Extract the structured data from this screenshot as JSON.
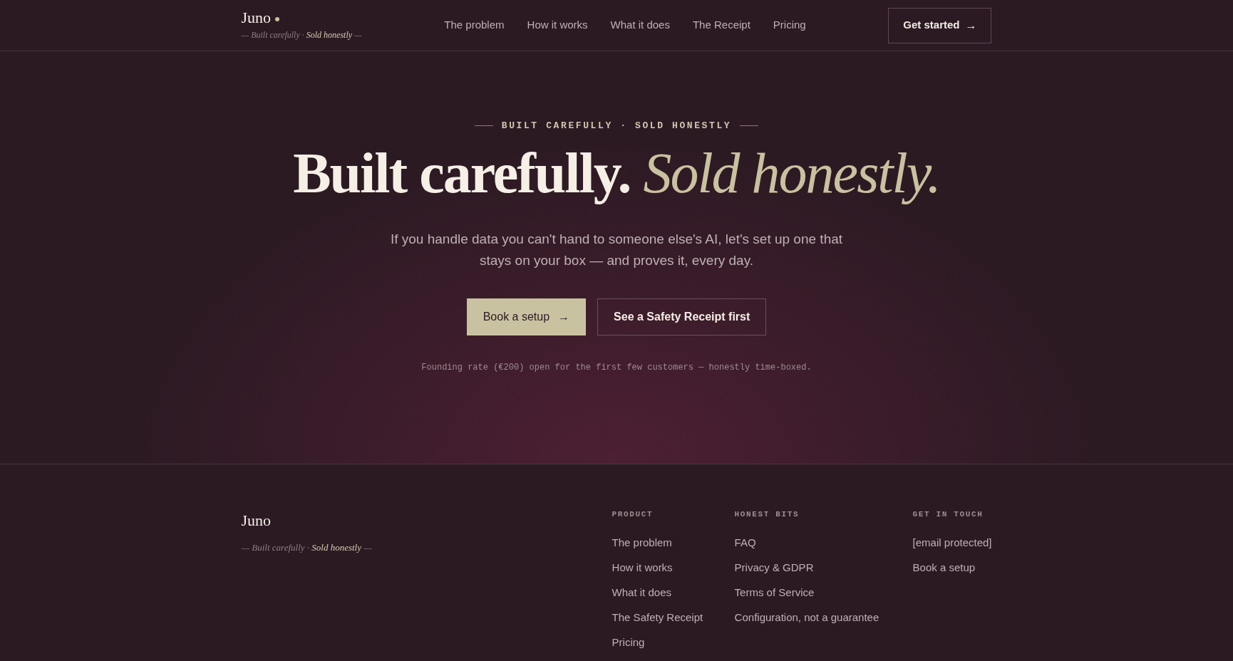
{
  "header": {
    "logo": "Juno",
    "tagline": [
      {
        "text": "— Built carefully ·",
        "kind": "muted"
      },
      {
        "text": "Sold honestly",
        "kind": "highlight"
      },
      {
        "text": "—",
        "kind": "muted"
      }
    ],
    "nav": [
      "The problem",
      "How it works",
      "What it does",
      "The Receipt",
      "Pricing"
    ],
    "cta": {
      "label": "Get started",
      "arrow": "→"
    }
  },
  "hero": {
    "eyebrow": "BUILT CAREFULLY · SOLD HONESTLY",
    "headline": {
      "plain": "Built carefully.",
      "accent": "Sold honestly."
    },
    "lead": "If you handle data you can't hand to someone else's AI, let's set up one that stays on your box — and proves it, every day.",
    "buttons": [
      {
        "label": "Book a setup",
        "arrow": "→",
        "kind": "primary"
      },
      {
        "label": "See a Safety Receipt first",
        "kind": "outline"
      }
    ],
    "note": "Founding rate (€200) open for the first few customers — honestly time-boxed."
  },
  "footer": {
    "logo": "Juno",
    "tagline": [
      {
        "text": "— Built carefully ·",
        "kind": "muted"
      },
      {
        "text": "Sold honestly",
        "kind": "highlight"
      },
      {
        "text": "—",
        "kind": "muted"
      }
    ],
    "columns": [
      {
        "heading": "PRODUCT",
        "links": [
          "The problem",
          "How it works",
          "What it does",
          "The Safety Receipt",
          "Pricing"
        ]
      },
      {
        "heading": "HONEST BITS",
        "links": [
          "FAQ",
          "Privacy & GDPR",
          "Terms of Service",
          "Configuration, not a guarantee"
        ]
      },
      {
        "heading": "GET IN TOUCH",
        "links": [
          "[email protected]",
          "Book a setup"
        ]
      }
    ]
  }
}
